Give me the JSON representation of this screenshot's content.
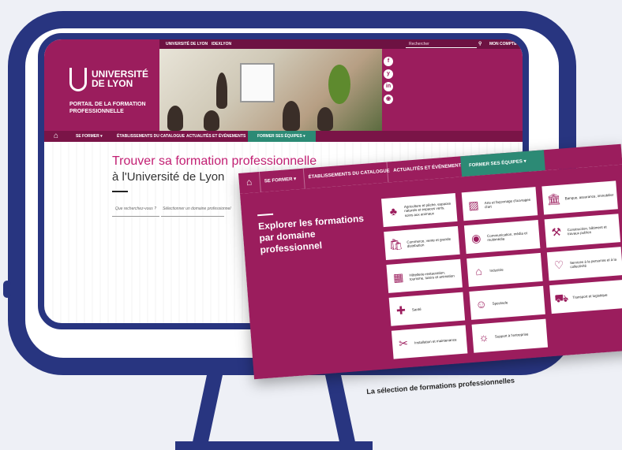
{
  "site": {
    "logo_line1": "UNIVERSITÉ",
    "logo_line2": "DE LYON",
    "portal_title": "PORTAIL DE LA FORMATION PROFESSIONNELLE",
    "topbar": {
      "link1": "UNIVERSITÉ DE LYON",
      "link2": "IDEXLYON",
      "search_placeholder": "Rechercher",
      "account": "MON COMPTE"
    },
    "social": [
      "f",
      "y",
      "in",
      "◉"
    ],
    "nav": [
      "SE FORMER ▾",
      "ÉTABLISSEMENTS DU CATALOGUE",
      "ACTUALITÉS ET ÉVÉNEMENTS",
      "FORMER SES ÉQUIPES ▾"
    ],
    "title": "Trouver sa formation professionnelle",
    "subtitle": "à l'Université de Lyon",
    "search_q_placeholder": "Que recherchez-vous ?",
    "search_domain_placeholder": "Sélectionner un domaine professionnel"
  },
  "overlay": {
    "nav": [
      "SE FORMER ▾",
      "ÉTABLISSEMENTS DU CATALOGUE",
      "ACTUALITÉS ET ÉVÉNEMENTS",
      "FORMER SES ÉQUIPES ▾"
    ],
    "title": "Explorer les formations par domaine professionnel",
    "tiles": [
      {
        "label": "Agriculture et pêche, espaces naturels et espaces verts, soins aux animaux",
        "icon": "♣"
      },
      {
        "label": "Arts et façonnage d'ouvrages d'art",
        "icon": "▨"
      },
      {
        "label": "Banque, assurance, immobilier",
        "icon": "🏛"
      },
      {
        "label": "Commerce, vente et grande distribution",
        "icon": "🛍"
      },
      {
        "label": "Communication, média et multimédia",
        "icon": "◉"
      },
      {
        "label": "Construction, bâtiment et travaux publics",
        "icon": "⚒"
      },
      {
        "label": "Hôtellerie-restauration, tourisme, loisirs et animation",
        "icon": "▦"
      },
      {
        "label": "Industrie",
        "icon": "⌂"
      },
      {
        "label": "Services à la personne et à la collectivité",
        "icon": "♡"
      },
      {
        "label": "Santé",
        "icon": "✚"
      },
      {
        "label": "Spectacle",
        "icon": "☺"
      },
      {
        "label": "Transport et logistique",
        "icon": "⛟"
      },
      {
        "label": "Installation et maintenance",
        "icon": "✂"
      },
      {
        "label": "Support à l'entreprise",
        "icon": "☼"
      }
    ]
  },
  "caption": "La sélection de formations professionnelles"
}
